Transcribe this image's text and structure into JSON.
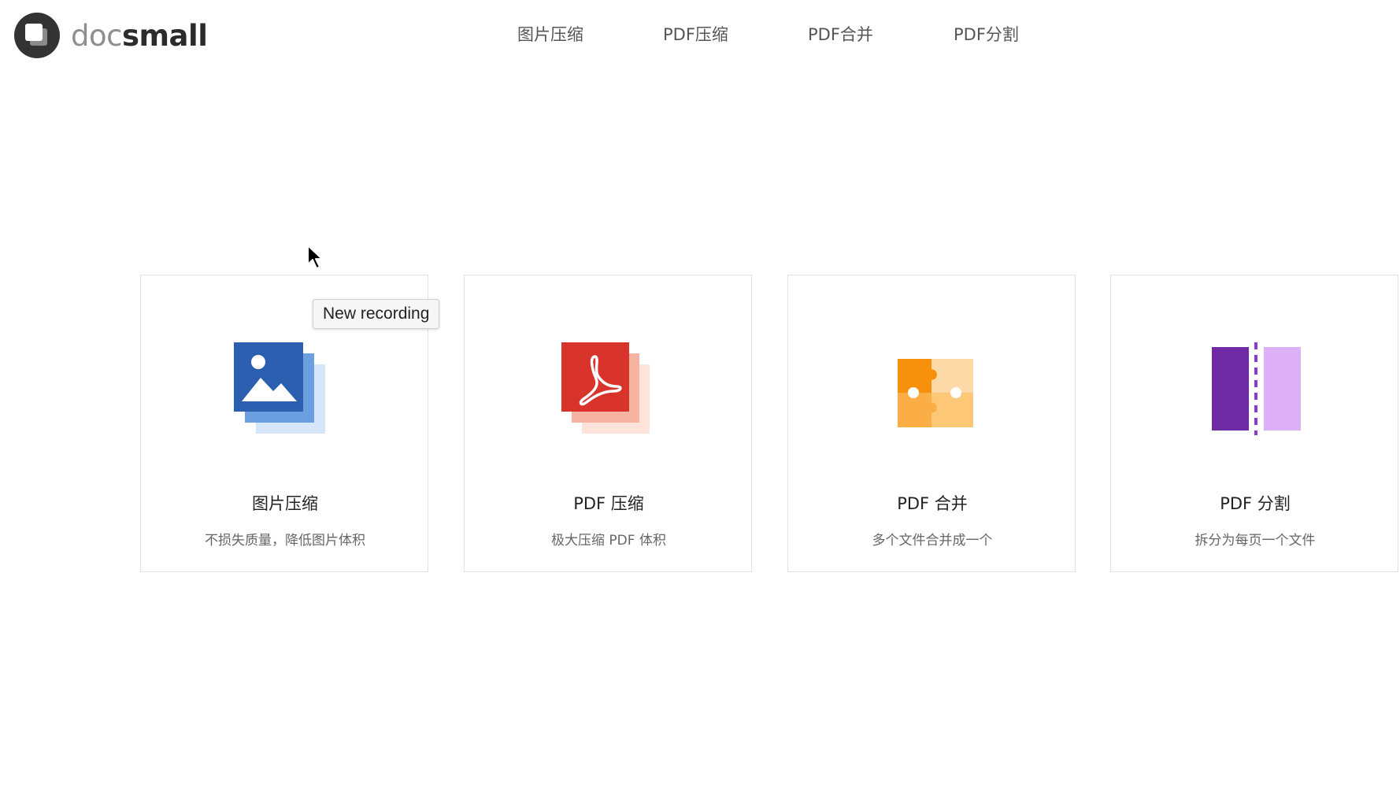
{
  "logo": {
    "text_light": "doc",
    "text_bold": "small"
  },
  "nav": {
    "items": [
      {
        "label": "图片压缩"
      },
      {
        "label": "PDF压缩"
      },
      {
        "label": "PDF合并"
      },
      {
        "label": "PDF分割"
      }
    ]
  },
  "cards": [
    {
      "title": "图片压缩",
      "description": "不损失质量，降低图片体积",
      "icon": "image-icon",
      "color": "#2d5fb0"
    },
    {
      "title": "PDF 压缩",
      "description": "极大压缩 PDF 体积",
      "icon": "pdf-icon",
      "color": "#d9342b"
    },
    {
      "title": "PDF 合并",
      "description": "多个文件合并成一个",
      "icon": "puzzle-icon",
      "color": "#f7900a"
    },
    {
      "title": "PDF 分割",
      "description": "拆分为每页一个文件",
      "icon": "split-icon",
      "color": "#6f2aa6"
    }
  ],
  "tooltip": {
    "text": "New recording"
  },
  "cursor": {
    "icon": "arrow-cursor-icon"
  }
}
